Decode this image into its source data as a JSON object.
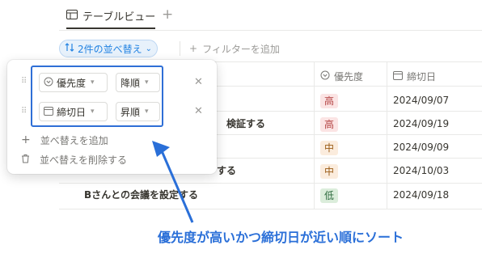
{
  "view": {
    "title": "テーブルビュー",
    "add_symbol": "+"
  },
  "toolbar": {
    "sort_pill_label": "2件の並べ替え",
    "add_filter_label": "フィルターを追加"
  },
  "table": {
    "columns": {
      "priority": "優先度",
      "deadline": "締切日"
    },
    "rows": [
      {
        "title": "",
        "priority": "高",
        "priority_level": "high",
        "deadline": "2024/09/07"
      },
      {
        "title": "検証する",
        "priority": "高",
        "priority_level": "high",
        "deadline": "2024/09/19"
      },
      {
        "title": "",
        "priority": "中",
        "priority_level": "mid",
        "deadline": "2024/09/09"
      },
      {
        "title": "する",
        "priority": "中",
        "priority_level": "mid",
        "deadline": "2024/10/03"
      },
      {
        "title": "Bさんとの会議を設定する",
        "priority": "低",
        "priority_level": "low",
        "deadline": "2024/09/18"
      }
    ]
  },
  "sort_popup": {
    "rules": [
      {
        "property": "優先度",
        "direction": "降順"
      },
      {
        "property": "締切日",
        "direction": "昇順"
      }
    ],
    "add_sort": "並べ替えを追加",
    "remove_sort": "並べ替えを削除する"
  },
  "annotation": {
    "text": "優先度が高いかつ締切日が近い順にソート",
    "color": "#2a6fd8"
  },
  "colors": {
    "accent": "#2383e2",
    "tag_high_bg": "#fbe4e4",
    "tag_mid_bg": "#fbecdd",
    "tag_low_bg": "#dbeddb"
  }
}
